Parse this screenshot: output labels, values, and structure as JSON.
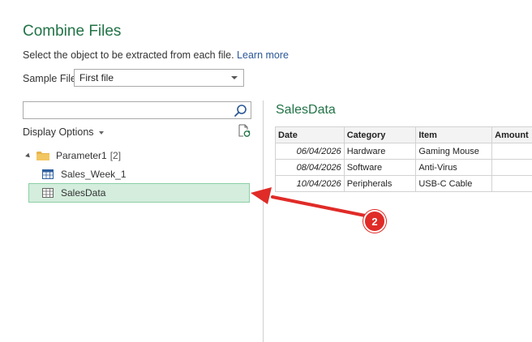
{
  "dialog": {
    "title": "Combine Files",
    "subtitle": "Select the object to be extracted from each file.",
    "learn_more": "Learn more"
  },
  "sample_file": {
    "label": "Sample File:",
    "value": "First file"
  },
  "navigator": {
    "search_value": "",
    "display_options": "Display Options",
    "tree": {
      "root_label": "Parameter1",
      "root_count": "[2]",
      "items": [
        {
          "label": "Sales_Week_1",
          "selected": false
        },
        {
          "label": "SalesData",
          "selected": true
        }
      ]
    }
  },
  "preview": {
    "title": "SalesData",
    "columns": [
      "Date",
      "Category",
      "Item",
      "Amount"
    ],
    "rows": [
      [
        "06/04/2026",
        "Hardware",
        "Gaming Mouse",
        ""
      ],
      [
        "08/04/2026",
        "Software",
        "Anti-Virus",
        ""
      ],
      [
        "10/04/2026",
        "Peripherals",
        "USB-C Cable",
        ""
      ]
    ]
  },
  "annotation": {
    "badge": "2",
    "color": "#e02b27"
  },
  "colors": {
    "accent": "#217346",
    "link": "#2b5797",
    "selection_bg": "#d4eddd",
    "selection_border": "#8ccfa5"
  }
}
